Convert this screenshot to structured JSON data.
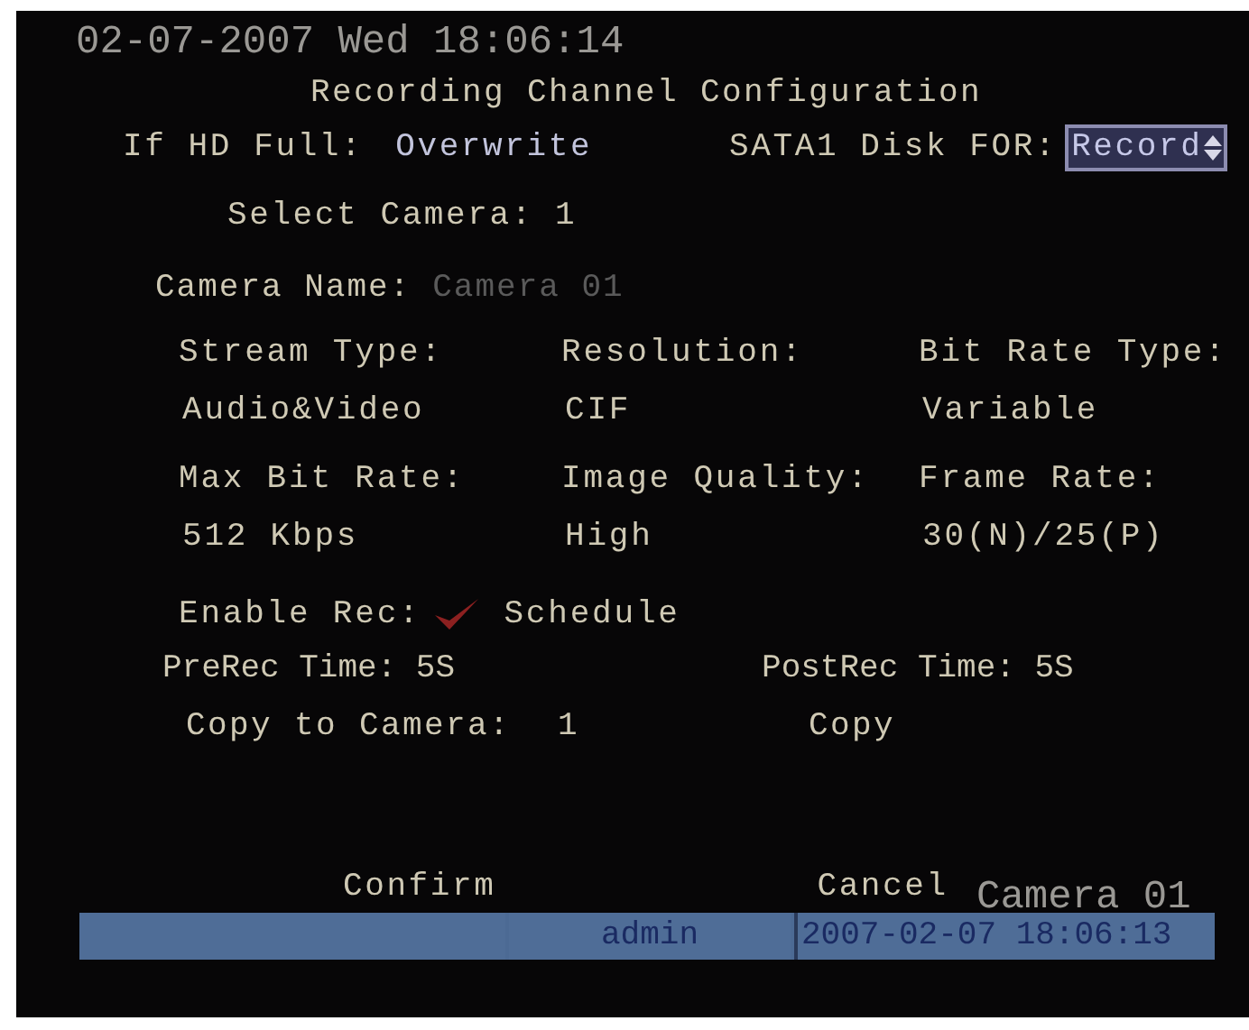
{
  "osd_timestamp": "02-07-2007 Wed 18:06:14",
  "title": "Recording Channel Configuration",
  "if_hd_full": {
    "label": "If HD Full:",
    "value": "Overwrite"
  },
  "sata_disk": {
    "label": "SATA1 Disk FOR:",
    "value": "Record"
  },
  "select_camera": {
    "label": "Select Camera:",
    "value": "1"
  },
  "camera_name": {
    "label": "Camera Name:",
    "value": "Camera 01",
    "disabled": true
  },
  "settings": [
    {
      "label": "Stream Type:",
      "value": "Audio&Video"
    },
    {
      "label": "Resolution:",
      "value": "CIF"
    },
    {
      "label": "Bit Rate Type:",
      "value": "Variable"
    },
    {
      "label": "Max Bit Rate:",
      "value": "512 Kbps"
    },
    {
      "label": "Image Quality:",
      "value": "High"
    },
    {
      "label": "Frame Rate:",
      "value": "30(N)/25(P)"
    }
  ],
  "enable_rec": {
    "label": "Enable Rec:",
    "checked": true
  },
  "schedule_button": "Schedule",
  "prerec": {
    "label": "PreRec Time:",
    "value": "5S"
  },
  "postrec": {
    "label": "PostRec Time:",
    "value": "5S"
  },
  "copy_to_camera": {
    "label": "Copy to Camera:",
    "value": "1"
  },
  "copy_button": "Copy",
  "buttons": [
    "Confirm",
    "Cancel"
  ],
  "status_bar": {
    "user": "admin",
    "datetime": "2007-02-07 18:06:13"
  },
  "osd_camera": "Camera 01"
}
